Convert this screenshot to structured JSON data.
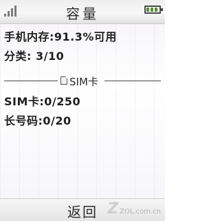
{
  "header": {
    "title": "容量",
    "signal_icon": "signal-strength-icon",
    "battery_icon": "battery-icon"
  },
  "content": {
    "phone_memory": "手机内存:91.3%可用",
    "categories": "分类: 3/10",
    "section_label": "SIM卡",
    "section_icon": "sim-card-icon",
    "sim_card": "SIM卡:0/250",
    "long_number": "长号码:0/20"
  },
  "footer": {
    "back_label": "返回",
    "watermark": "ZOL.com.cn"
  }
}
